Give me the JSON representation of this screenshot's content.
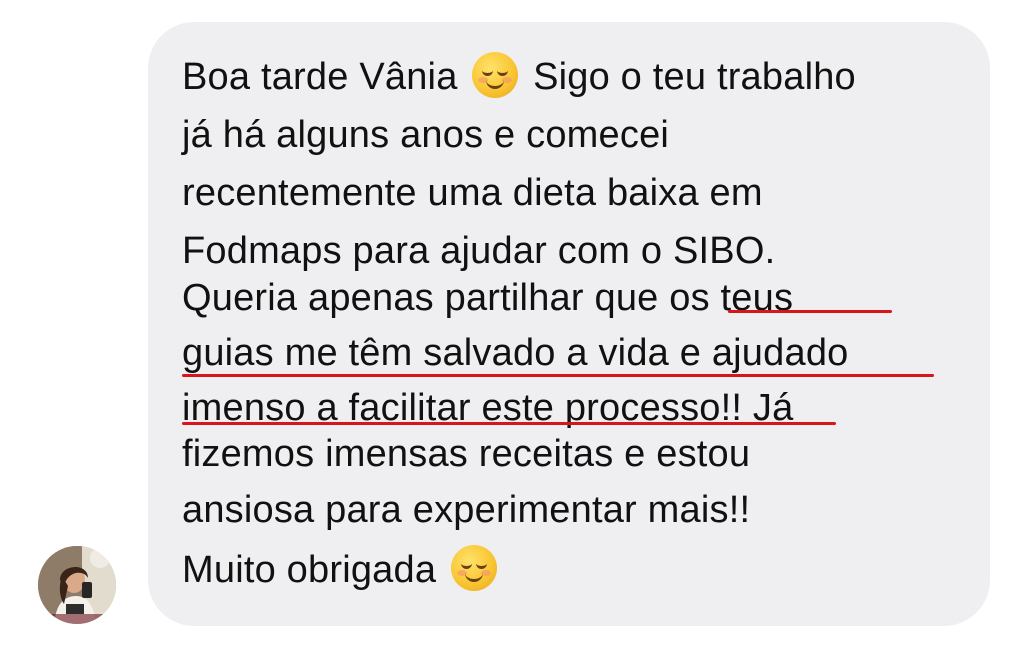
{
  "message": {
    "lines": [
      "Boa tarde Vânia",
      "Sigo o teu trabalho",
      "já há alguns anos e comecei",
      "recentemente uma dieta baixa em",
      "Fodmaps para ajudar com o SIBO.",
      "Queria apenas partilhar que os teus",
      "guias me têm salvado a vida e ajudado",
      "imenso a facilitar este processo!! Já",
      "fizemos imensas receitas e estou",
      "ansiosa para experimentar mais!!",
      "Muito obrigada"
    ],
    "emoji": "smiling-face-icon",
    "highlight_color": "#d9141a"
  },
  "colors": {
    "bubble": "#efeff1",
    "text": "#111111"
  },
  "avatar": {
    "icon": "profile-photo"
  }
}
